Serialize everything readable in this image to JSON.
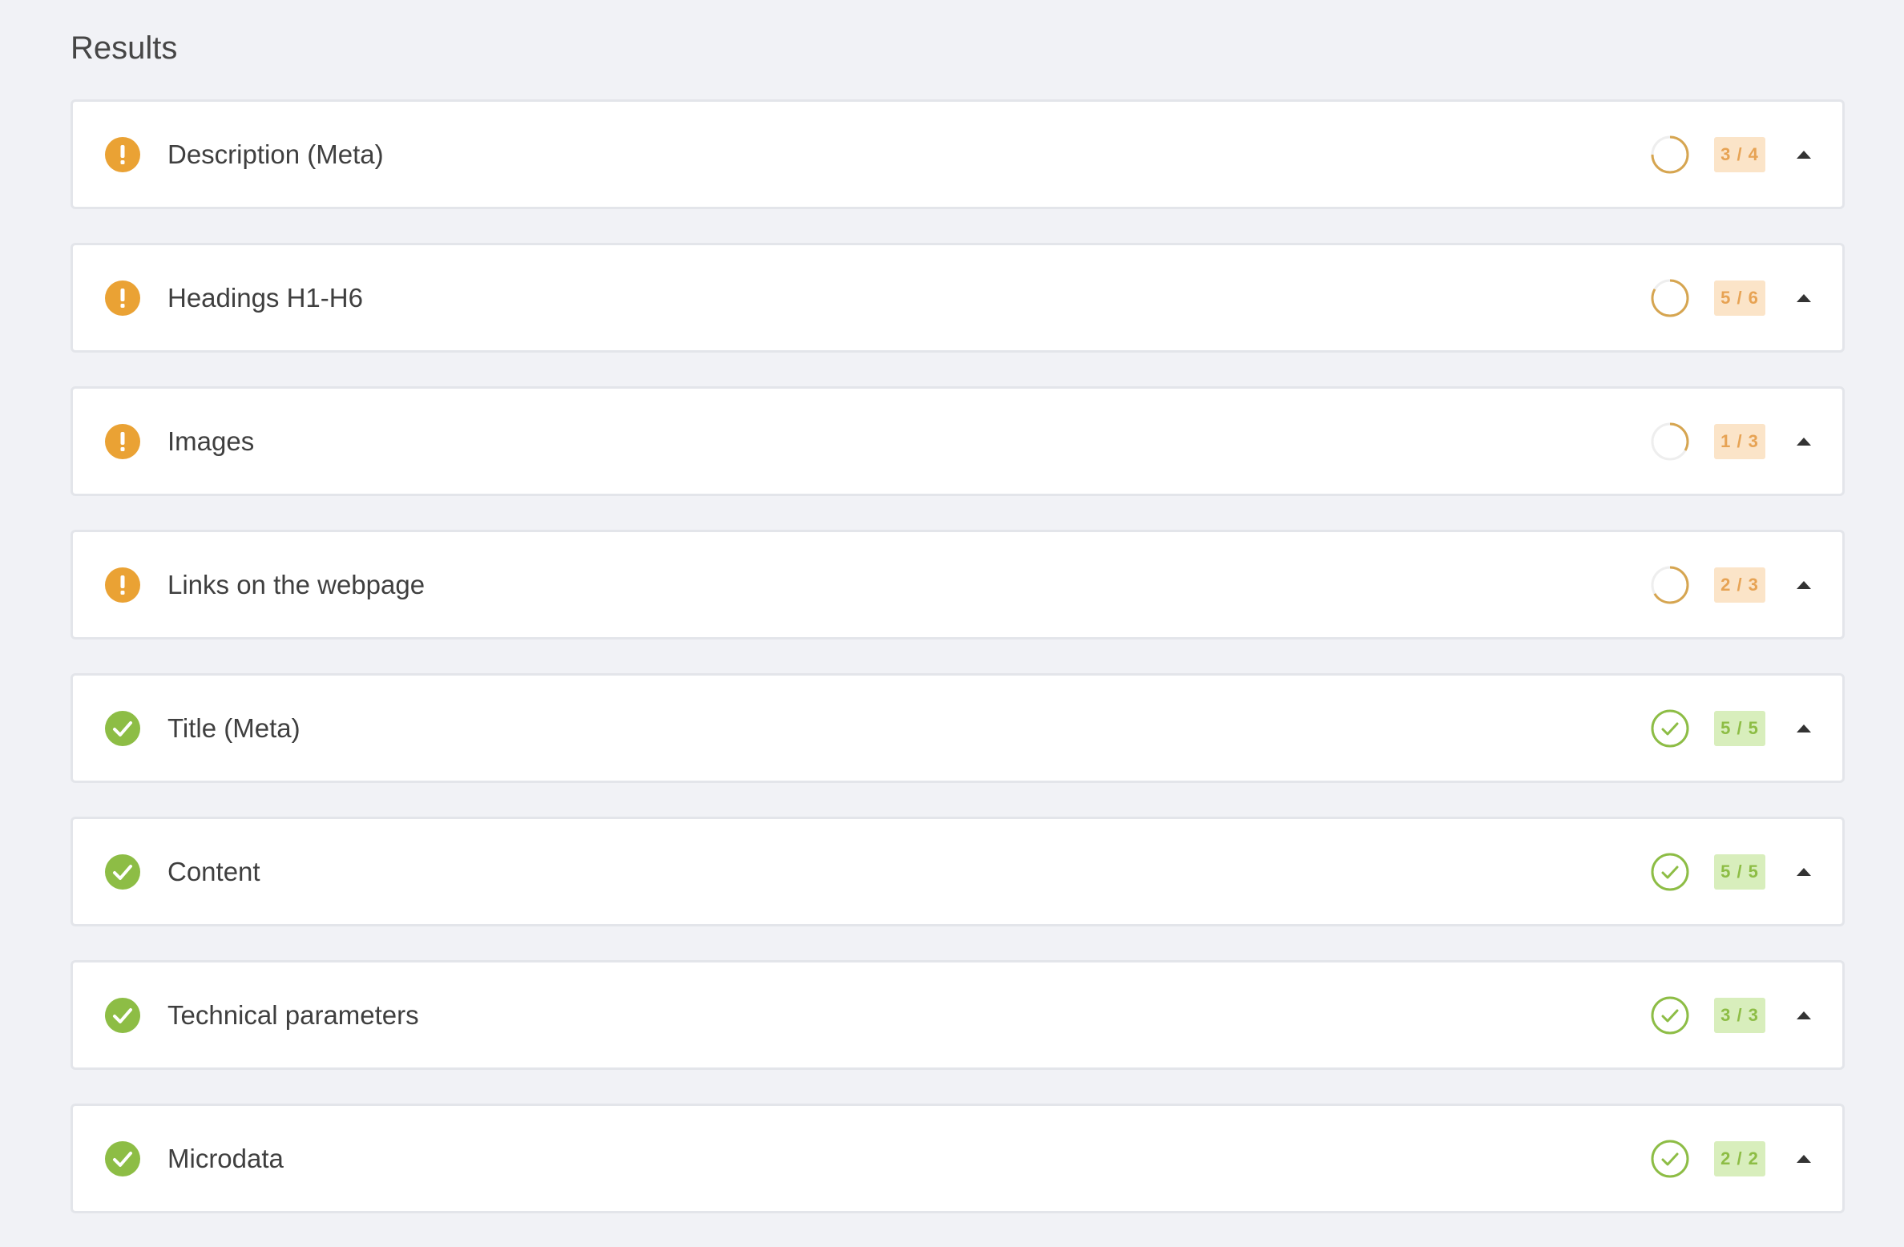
{
  "title": "Results",
  "colors": {
    "warning": "#eaa234",
    "warning_ring": "#d6a550",
    "warning_badge_bg": "#fbe4c8",
    "warning_badge_text": "#e7a354",
    "success": "#8dbd45",
    "success_ring": "#8dbd45",
    "success_badge_bg": "#d8eebc",
    "success_badge_text": "#8dbd45"
  },
  "items": [
    {
      "label": "Description (Meta)",
      "status": "warning",
      "status_icon": "exclamation-icon",
      "score": "3 / 4",
      "passed": 3,
      "total": 4,
      "toggle_icon": "caret-up-icon"
    },
    {
      "label": "Headings H1-H6",
      "status": "warning",
      "status_icon": "exclamation-icon",
      "score": "5 / 6",
      "passed": 5,
      "total": 6,
      "toggle_icon": "caret-up-icon"
    },
    {
      "label": "Images",
      "status": "warning",
      "status_icon": "exclamation-icon",
      "score": "1 / 3",
      "passed": 1,
      "total": 3,
      "toggle_icon": "caret-up-icon"
    },
    {
      "label": "Links on the webpage",
      "status": "warning",
      "status_icon": "exclamation-icon",
      "score": "2 / 3",
      "passed": 2,
      "total": 3,
      "toggle_icon": "caret-up-icon"
    },
    {
      "label": "Title (Meta)",
      "status": "success",
      "status_icon": "checkmark-icon",
      "score": "5 / 5",
      "passed": 5,
      "total": 5,
      "toggle_icon": "caret-up-icon"
    },
    {
      "label": "Content",
      "status": "success",
      "status_icon": "checkmark-icon",
      "score": "5 / 5",
      "passed": 5,
      "total": 5,
      "toggle_icon": "caret-up-icon"
    },
    {
      "label": "Technical parameters",
      "status": "success",
      "status_icon": "checkmark-icon",
      "score": "3 / 3",
      "passed": 3,
      "total": 3,
      "toggle_icon": "caret-up-icon"
    },
    {
      "label": "Microdata",
      "status": "success",
      "status_icon": "checkmark-icon",
      "score": "2 / 2",
      "passed": 2,
      "total": 2,
      "toggle_icon": "caret-up-icon"
    }
  ]
}
